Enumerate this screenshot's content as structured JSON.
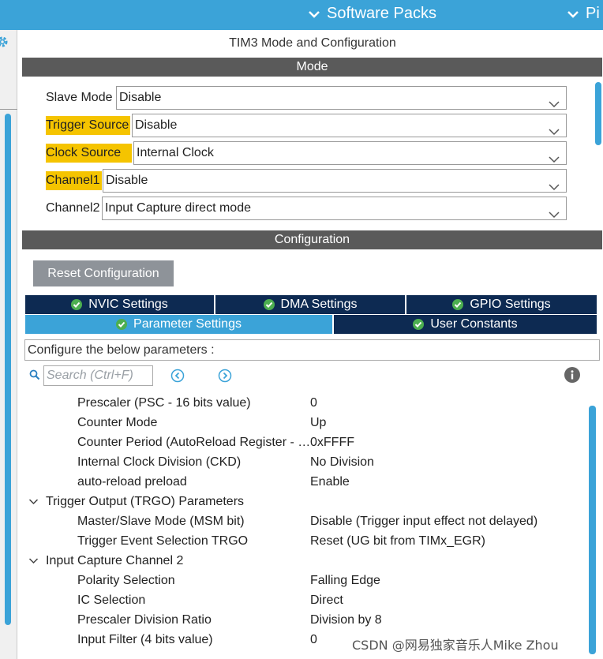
{
  "topbar": {
    "software_packs": "Software Packs",
    "pinout_partial": "Pi"
  },
  "panel_title": "TIM3 Mode and Configuration",
  "mode": {
    "header": "Mode",
    "rows": [
      {
        "label": "Slave Mode",
        "value": "Disable"
      },
      {
        "label": "Trigger Source",
        "value": "Disable"
      },
      {
        "label": "Clock Source",
        "value": "Internal Clock"
      },
      {
        "label": "Channel1",
        "value": "Disable"
      },
      {
        "label": "Channel2",
        "value": "Input Capture direct mode"
      }
    ]
  },
  "configuration": {
    "header": "Configuration",
    "reset_label": "Reset Configuration",
    "tabs": {
      "nvic": "NVIC Settings",
      "dma": "DMA Settings",
      "gpio": "GPIO Settings",
      "parameter": "Parameter Settings",
      "user_constants": "User Constants"
    },
    "description": "Configure the below parameters :",
    "search_placeholder": "Search (Ctrl+F)",
    "params": {
      "prescaler": {
        "name": "Prescaler (PSC - 16 bits value)",
        "value": "0"
      },
      "counter_mode": {
        "name": "Counter Mode",
        "value": "Up"
      },
      "counter_period": {
        "name": "Counter Period (AutoReload Register - 1...",
        "value": "0xFFFF"
      },
      "clock_division": {
        "name": "Internal Clock Division (CKD)",
        "value": "No Division"
      },
      "auto_reload": {
        "name": "auto-reload preload",
        "value": "Enable"
      },
      "trgo_group": "Trigger Output (TRGO) Parameters",
      "msm": {
        "name": "Master/Slave Mode (MSM bit)",
        "value": "Disable (Trigger input effect not delayed)"
      },
      "trgo_event": {
        "name": "Trigger Event Selection TRGO",
        "value": "Reset (UG bit from TIMx_EGR)"
      },
      "ic2_group": "Input Capture Channel 2",
      "polarity": {
        "name": "Polarity Selection",
        "value": "Falling Edge"
      },
      "ic_selection": {
        "name": "IC Selection",
        "value": "Direct"
      },
      "prescaler_div": {
        "name": "Prescaler Division Ratio",
        "value": "Division by 8"
      },
      "input_filter": {
        "name": "Input Filter (4 bits value)",
        "value": "0"
      }
    }
  },
  "watermark": "CSDN @网易独家音乐人Mike Zhou",
  "colors": {
    "accent": "#3ba3d8",
    "band": "#5a5a5a",
    "tab_dark": "#0d2a52",
    "highlight": "#f5c400",
    "check_green": "#4caf50"
  }
}
